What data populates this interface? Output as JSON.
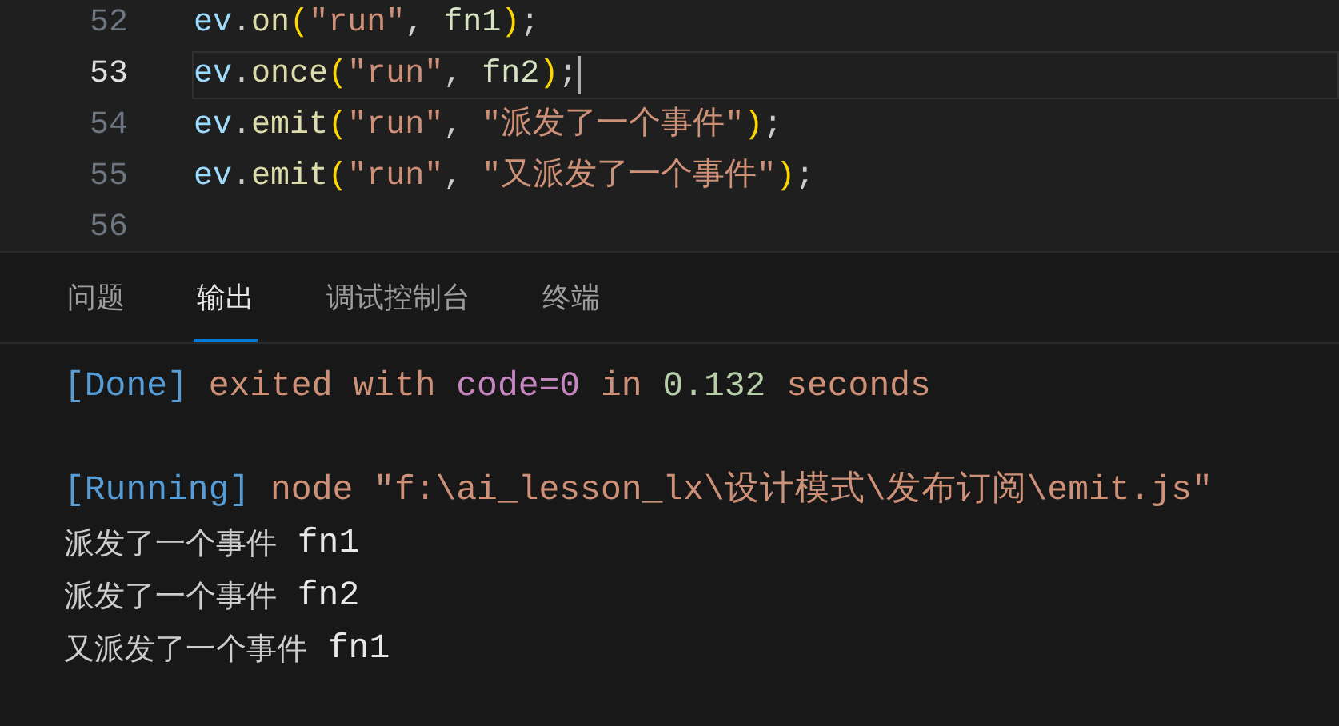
{
  "editor": {
    "lines": [
      {
        "number": "52",
        "current": false,
        "tokens": [
          {
            "text": "ev",
            "kind": "variable"
          },
          {
            "text": ".",
            "kind": "punct"
          },
          {
            "text": "on",
            "kind": "function"
          },
          {
            "text": "(",
            "kind": "paren"
          },
          {
            "text": "\"run\"",
            "kind": "string"
          },
          {
            "text": ", ",
            "kind": "punct"
          },
          {
            "text": "fn1",
            "kind": "identifier"
          },
          {
            "text": ")",
            "kind": "paren"
          },
          {
            "text": ";",
            "kind": "punct"
          }
        ]
      },
      {
        "number": "53",
        "current": true,
        "tokens": [
          {
            "text": "ev",
            "kind": "variable"
          },
          {
            "text": ".",
            "kind": "punct"
          },
          {
            "text": "once",
            "kind": "function"
          },
          {
            "text": "(",
            "kind": "paren"
          },
          {
            "text": "\"run\"",
            "kind": "string"
          },
          {
            "text": ", ",
            "kind": "punct"
          },
          {
            "text": "fn2",
            "kind": "identifier"
          },
          {
            "text": ")",
            "kind": "paren"
          },
          {
            "text": ";",
            "kind": "punct"
          }
        ]
      },
      {
        "number": "54",
        "current": false,
        "tokens": [
          {
            "text": "ev",
            "kind": "variable"
          },
          {
            "text": ".",
            "kind": "punct"
          },
          {
            "text": "emit",
            "kind": "function"
          },
          {
            "text": "(",
            "kind": "paren"
          },
          {
            "text": "\"run\"",
            "kind": "string"
          },
          {
            "text": ", ",
            "kind": "punct"
          },
          {
            "text": "\"派发了一个事件\"",
            "kind": "string"
          },
          {
            "text": ")",
            "kind": "paren"
          },
          {
            "text": ";",
            "kind": "punct"
          }
        ]
      },
      {
        "number": "55",
        "current": false,
        "tokens": [
          {
            "text": "ev",
            "kind": "variable"
          },
          {
            "text": ".",
            "kind": "punct"
          },
          {
            "text": "emit",
            "kind": "function"
          },
          {
            "text": "(",
            "kind": "paren"
          },
          {
            "text": "\"run\"",
            "kind": "string"
          },
          {
            "text": ", ",
            "kind": "punct"
          },
          {
            "text": "\"又派发了一个事件\"",
            "kind": "string"
          },
          {
            "text": ")",
            "kind": "paren"
          },
          {
            "text": ";",
            "kind": "punct"
          }
        ]
      },
      {
        "number": "56",
        "current": false
      }
    ]
  },
  "panel": {
    "tabs": [
      {
        "label": "问题",
        "selected": false
      },
      {
        "label": "输出",
        "selected": true
      },
      {
        "label": "调试控制台",
        "selected": false
      },
      {
        "label": "终端",
        "selected": false
      }
    ],
    "output": [
      {
        "lines": [
          {
            "segments": [
              {
                "text": "[Done]",
                "kind": "tag"
              },
              {
                "text": " exited with ",
                "kind": "message"
              },
              {
                "text": "code=0",
                "kind": "code"
              },
              {
                "text": " in ",
                "kind": "message"
              },
              {
                "text": "0.132",
                "kind": "number"
              },
              {
                "text": " seconds",
                "kind": "message"
              }
            ]
          }
        ]
      },
      {
        "lines": [
          {
            "segments": [
              {
                "text": "[Running]",
                "kind": "tag"
              },
              {
                "text": " node \"f:\\ai_lesson_lx\\设计模式\\发布订阅\\emit.js\"",
                "kind": "message"
              }
            ]
          },
          {
            "segments": [
              {
                "text": "派发了一个事件",
                "kind": "plain"
              },
              {
                "text": " fn1",
                "kind": "identifier"
              }
            ]
          },
          {
            "segments": [
              {
                "text": "派发了一个事件",
                "kind": "plain"
              },
              {
                "text": " fn2",
                "kind": "identifier"
              }
            ]
          },
          {
            "segments": [
              {
                "text": "又派发了一个事件",
                "kind": "plain"
              },
              {
                "text": " fn1",
                "kind": "identifier"
              }
            ]
          }
        ]
      }
    ]
  }
}
